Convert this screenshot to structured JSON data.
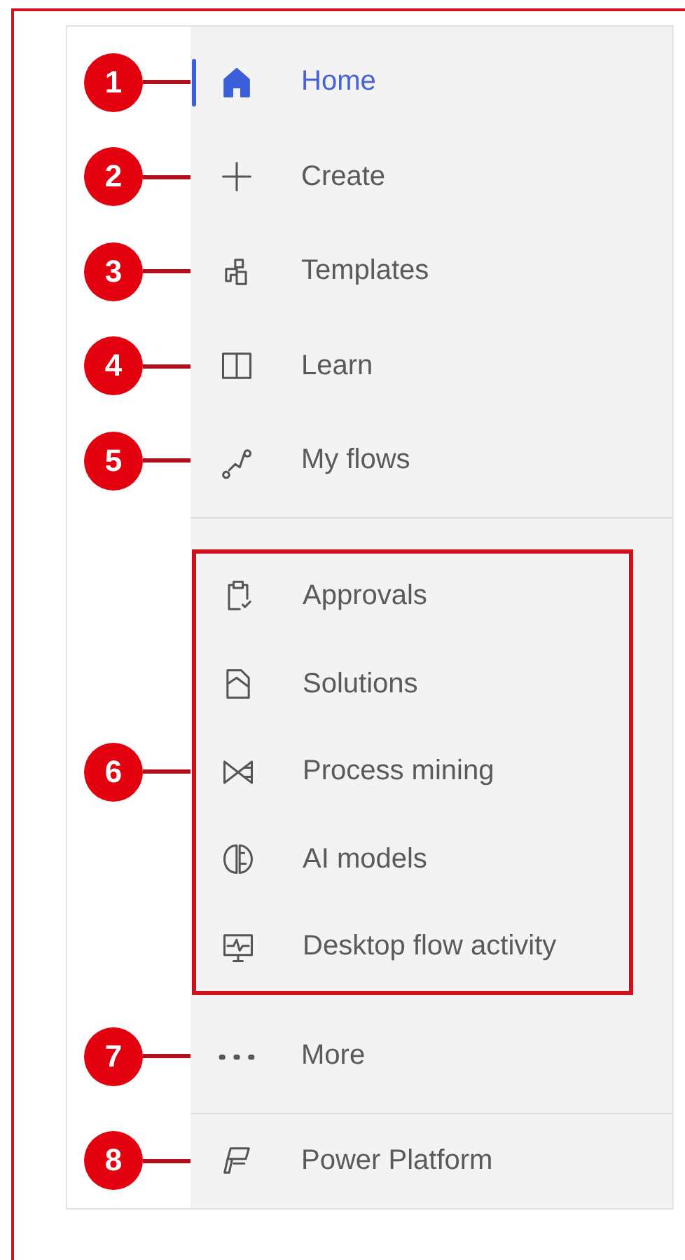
{
  "sections": [
    {
      "divider_after": true,
      "highlighted": false,
      "items": [
        {
          "label": "Home",
          "selected": true,
          "callout": "1"
        },
        {
          "label": "Create",
          "selected": false,
          "callout": "2"
        },
        {
          "label": "Templates",
          "selected": false,
          "callout": "3"
        },
        {
          "label": "Learn",
          "selected": false,
          "callout": "4"
        },
        {
          "label": "My flows",
          "selected": false,
          "callout": "5"
        }
      ]
    },
    {
      "divider_after": false,
      "highlighted": true,
      "callout": "6",
      "items": [
        {
          "label": "Approvals",
          "selected": false
        },
        {
          "label": "Solutions",
          "selected": false
        },
        {
          "label": "Process mining",
          "selected": false
        },
        {
          "label": "AI models",
          "selected": false
        },
        {
          "label": "Desktop flow activity",
          "selected": false
        }
      ]
    },
    {
      "divider_after": true,
      "highlighted": false,
      "items": [
        {
          "label": "More",
          "selected": false,
          "callout": "7"
        }
      ]
    },
    {
      "divider_after": false,
      "highlighted": false,
      "items": [
        {
          "label": "Power Platform",
          "selected": false,
          "callout": "8"
        }
      ]
    }
  ]
}
